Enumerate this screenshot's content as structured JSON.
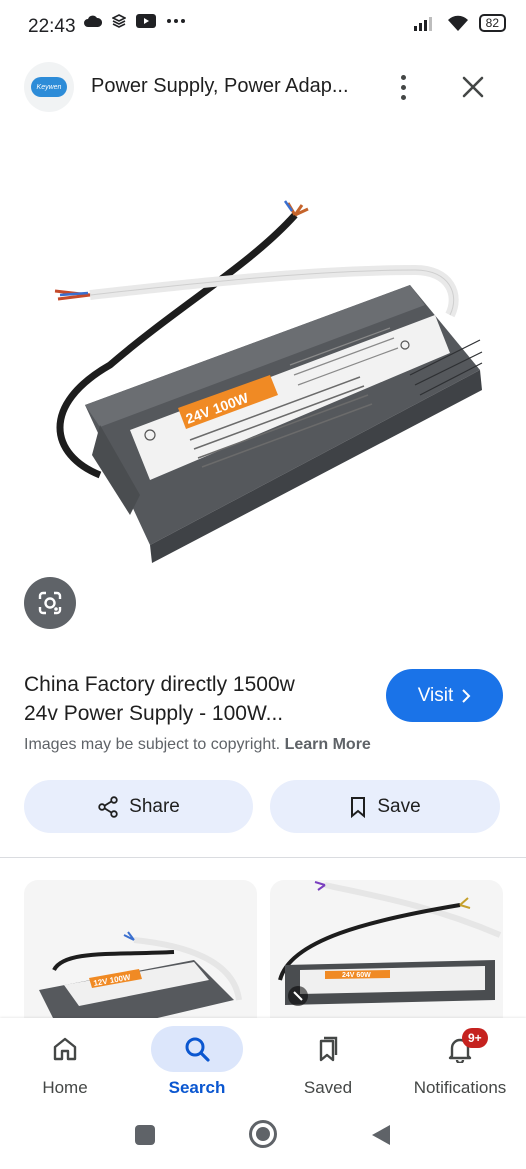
{
  "status_bar": {
    "time": "22:43",
    "battery": "82"
  },
  "header": {
    "site_title": "Power Supply, Power Adap...",
    "logo_text": "Keywen"
  },
  "product_image": {
    "label_main": "24V 100W"
  },
  "result": {
    "title_line1": "China Factory directly 1500w",
    "title_line2": "24v Power Supply - 100W...",
    "visit_label": "Visit",
    "copyright_text": "Images may be subject to copyright.",
    "learn_more": "Learn More"
  },
  "actions": {
    "share_label": "Share",
    "save_label": "Save"
  },
  "related": {
    "thumb1_label": "12V 100W",
    "thumb2_label": "24V 60W"
  },
  "bottom_nav": {
    "items": [
      {
        "label": "Home",
        "icon": "home-icon"
      },
      {
        "label": "Search",
        "icon": "search-icon"
      },
      {
        "label": "Saved",
        "icon": "saved-icon"
      },
      {
        "label": "Notifications",
        "icon": "bell-icon"
      }
    ],
    "notifications_badge": "9+"
  },
  "colors": {
    "accent": "#1a73e8",
    "chip_bg": "#e8eefc",
    "badge": "#c5221f"
  }
}
